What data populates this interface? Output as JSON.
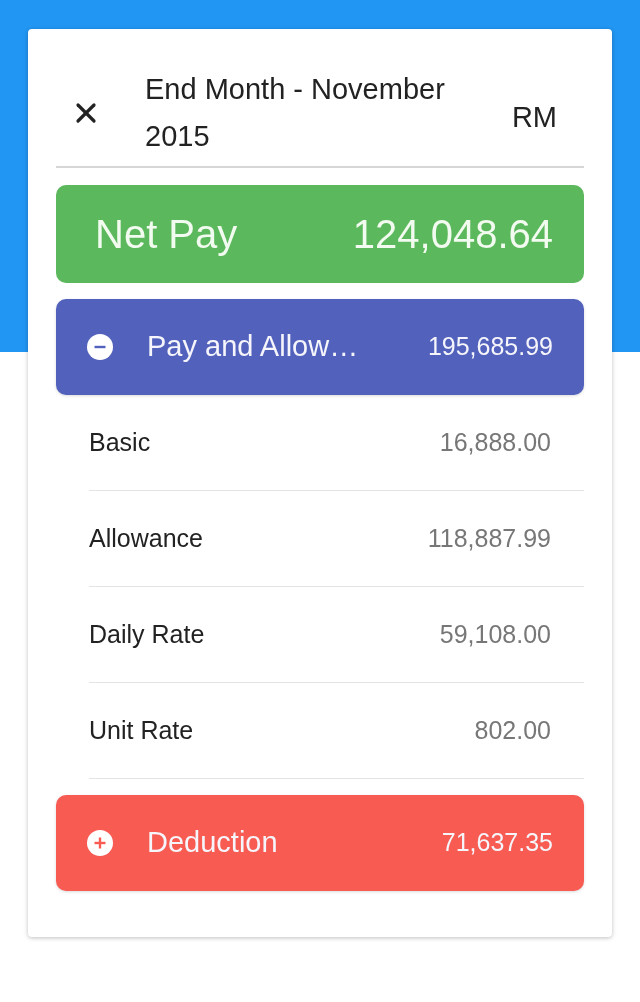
{
  "header": {
    "title": "End Month - November 2015",
    "currency": "RM"
  },
  "net_pay": {
    "label": "Net Pay",
    "amount": "124,048.64"
  },
  "sections": [
    {
      "label": "Pay and Allow…",
      "amount": "195,685.99",
      "color": "#5262bc",
      "expanded": true,
      "items": [
        {
          "label": "Basic",
          "amount": "16,888.00"
        },
        {
          "label": "Allowance",
          "amount": "118,887.99"
        },
        {
          "label": "Daily Rate",
          "amount": "59,108.00"
        },
        {
          "label": "Unit Rate",
          "amount": "802.00"
        }
      ]
    },
    {
      "label": "Deduction",
      "amount": "71,637.35",
      "color": "#f75b52",
      "expanded": false
    }
  ]
}
